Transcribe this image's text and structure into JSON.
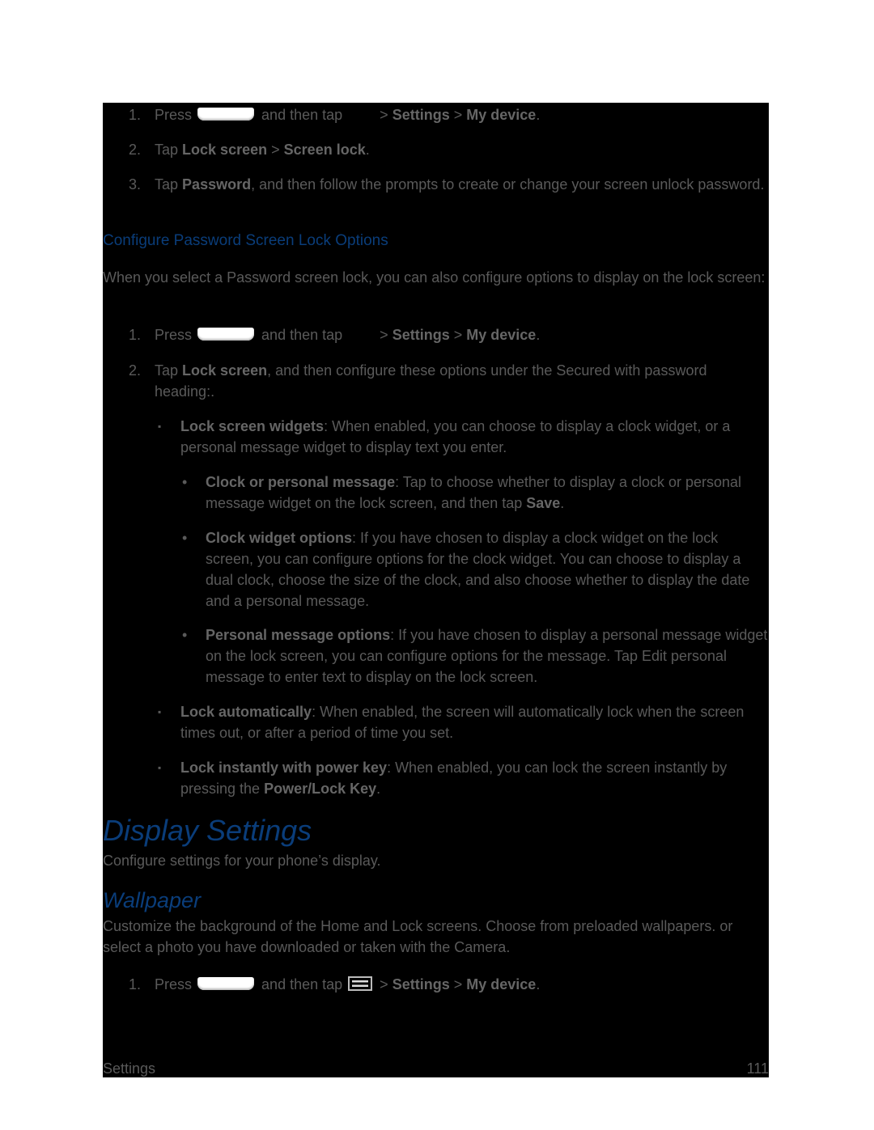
{
  "colors": {
    "heading": "#0a3d7a",
    "body_text": "#5a5a5a",
    "background": "#000000"
  },
  "steps_a": [
    {
      "num": "1.",
      "pre": "Press",
      "mid": "and then tap",
      "sep1": ">",
      "b1": "Settings",
      "sep2": ">",
      "b2": "My device",
      "end": "."
    },
    {
      "num": "2.",
      "pre": "Tap",
      "b1": "Lock screen",
      "sep": ">",
      "b2": "Screen lock",
      "end": "."
    },
    {
      "num": "3.",
      "pre": "Tap",
      "b1": "Password",
      "rest": ", and then follow the prompts to create or change your screen unlock password."
    }
  ],
  "section_password_options": {
    "heading": "Configure Password Screen Lock Options",
    "intro": "When you select a Password screen lock, you can also configure options to display on the lock screen:",
    "step1": {
      "num": "1.",
      "pre": "Press",
      "mid": "and then tap",
      "sep1": ">",
      "b1": "Settings",
      "sep2": ">",
      "b2": "My device",
      "end": "."
    },
    "step2": {
      "num": "2.",
      "pre": "Tap",
      "b1": "Lock screen",
      "rest": ", and then configure these options under the Secured with password heading:."
    },
    "bullets": [
      {
        "marker": "▪",
        "bold": "Lock screen widgets",
        "rest": ": When enabled, you can choose to display a clock widget, or a personal message widget to display text you enter."
      },
      {
        "marker": "▪",
        "bold": "Lock automatically",
        "rest": ": When enabled, the screen will automatically lock when the screen times out, or after a period of time you set."
      },
      {
        "marker": "▪",
        "bold": "Lock instantly with power key",
        "rest": ": When enabled, you can lock the screen instantly by pressing the ",
        "bold2": "Power/Lock Key",
        "end": "."
      }
    ],
    "sub_bullets": [
      {
        "marker": "•",
        "bold": "Clock or personal message",
        "rest": ": Tap to choose whether to display a clock or personal message widget on the lock screen, and then tap ",
        "bold2": "Save",
        "end": "."
      },
      {
        "marker": "•",
        "bold": "Clock widget options",
        "rest": ": If you have chosen to display a clock widget on the lock screen, you can configure options for the clock widget. You can choose to display a dual clock, choose the size of the clock, and also choose whether to display the date and a personal message."
      },
      {
        "marker": "•",
        "bold": "Personal message options",
        "rest": ": If you have chosen to display a personal message widget on the lock screen, you can configure options for the message. Tap Edit personal message to enter text to display on the lock screen."
      }
    ]
  },
  "display_settings": {
    "heading": "Display Settings",
    "intro": "Configure settings for your phone’s display."
  },
  "wallpaper": {
    "heading": "Wallpaper",
    "intro": "Customize the background of the Home and Lock screens. Choose from preloaded wallpapers. or select a photo you have downloaded or taken with the Camera.",
    "step1": {
      "num": "1.",
      "pre": "Press",
      "mid": "and then tap",
      "sep1": ">",
      "b1": "Settings",
      "sep2": ">",
      "b2": "My device",
      "end": "."
    }
  },
  "footer": {
    "section": "Settings",
    "page_number": "111"
  }
}
